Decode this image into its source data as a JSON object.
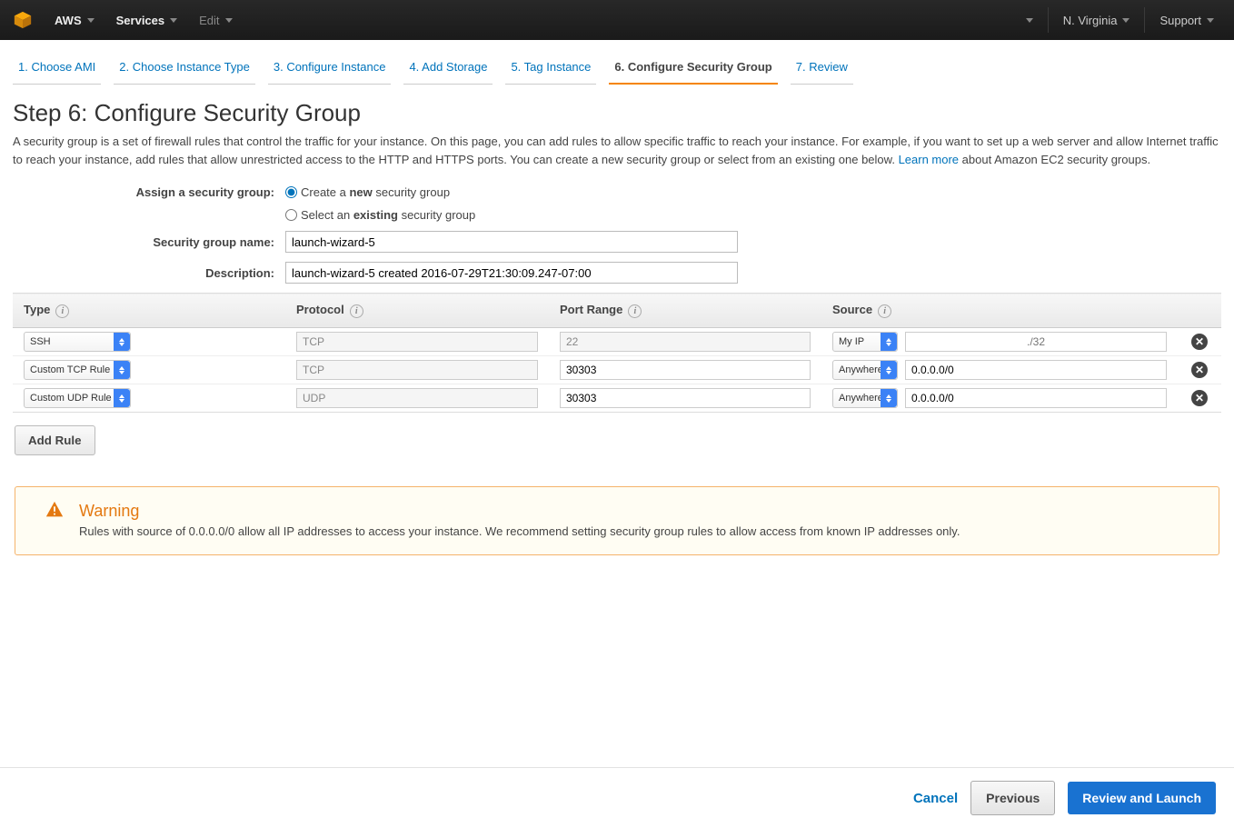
{
  "topnav": {
    "brand": "AWS",
    "services": "Services",
    "edit": "Edit",
    "region": "N. Virginia",
    "support": "Support"
  },
  "wizard": {
    "steps": [
      "1. Choose AMI",
      "2. Choose Instance Type",
      "3. Configure Instance",
      "4. Add Storage",
      "5. Tag Instance",
      "6. Configure Security Group",
      "7. Review"
    ],
    "active_index": 5
  },
  "heading": "Step 6: Configure Security Group",
  "description": "A security group is a set of firewall rules that control the traffic for your instance. On this page, you can add rules to allow specific traffic to reach your instance. For example, if you want to set up a web server and allow Internet traffic to reach your instance, add rules that allow unrestricted access to the HTTP and HTTPS ports. You can create a new security group or select from an existing one below.",
  "learn_more": "Learn more",
  "desc_tail": "about Amazon EC2 security groups.",
  "assign": {
    "label": "Assign a security group:",
    "create_pre": "Create a ",
    "create_bold": "new",
    "create_post": " security group",
    "select_pre": "Select an ",
    "select_bold": "existing",
    "select_post": " security group"
  },
  "sg_name_label": "Security group name:",
  "sg_name_value": "launch-wizard-5",
  "sg_desc_label": "Description:",
  "sg_desc_value": "launch-wizard-5 created 2016-07-29T21:30:09.247-07:00",
  "headers": {
    "type": "Type",
    "protocol": "Protocol",
    "port": "Port Range",
    "source": "Source"
  },
  "rules": [
    {
      "type": "SSH",
      "protocol": "TCP",
      "port": "22",
      "source_sel": "My IP",
      "source_val": "",
      "source_placeholder": "./32",
      "port_disabled": true,
      "proto_disabled": true
    },
    {
      "type": "Custom TCP Rule",
      "protocol": "TCP",
      "port": "30303",
      "source_sel": "Anywhere",
      "source_val": "0.0.0.0/0",
      "source_placeholder": "",
      "port_disabled": false,
      "proto_disabled": true
    },
    {
      "type": "Custom UDP Rule",
      "protocol": "UDP",
      "port": "30303",
      "source_sel": "Anywhere",
      "source_val": "0.0.0.0/0",
      "source_placeholder": "",
      "port_disabled": false,
      "proto_disabled": true
    }
  ],
  "add_rule": "Add Rule",
  "warning": {
    "title": "Warning",
    "msg": "Rules with source of 0.0.0.0/0 allow all IP addresses to access your instance. We recommend setting security group rules to allow access from known IP addresses only."
  },
  "footer": {
    "cancel": "Cancel",
    "previous": "Previous",
    "review": "Review and Launch"
  }
}
